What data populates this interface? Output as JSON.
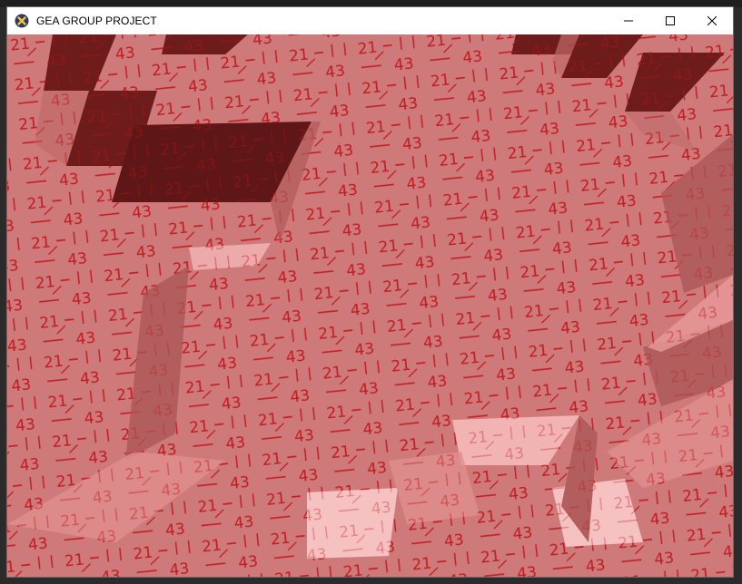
{
  "window": {
    "title": "GEA GROUP PROJECT",
    "app_icon": "x-logo-icon",
    "controls": [
      "minimize-icon",
      "maximize-icon",
      "close-icon"
    ]
  },
  "scene": {
    "texture_label_a": "21",
    "texture_label_b": "43",
    "colors": {
      "floor": "#cf7a7a",
      "floor_lit": "#f2b3b3",
      "wall": "#b96363",
      "pit": "#6e1b1b",
      "ink": "#c0141a"
    }
  }
}
